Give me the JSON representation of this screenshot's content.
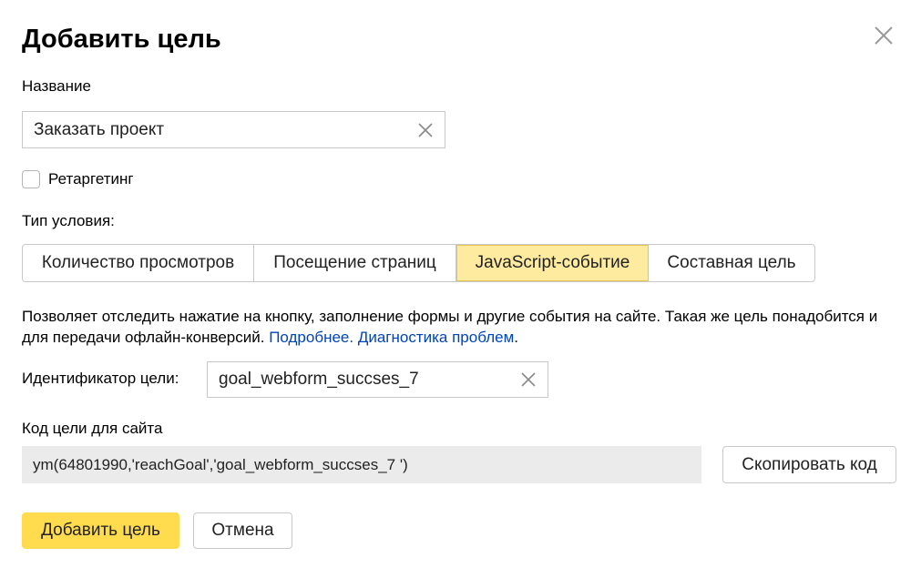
{
  "dialog": {
    "title": "Добавить цель"
  },
  "name_field": {
    "label": "Название",
    "value": "Заказать проект"
  },
  "retargeting": {
    "label": "Ретаргетинг",
    "checked": false
  },
  "condition_type": {
    "label": "Тип условия:",
    "options": [
      {
        "label": "Количество просмотров",
        "selected": false
      },
      {
        "label": "Посещение страниц",
        "selected": false
      },
      {
        "label": "JavaScript-событие",
        "selected": true
      },
      {
        "label": "Составная цель",
        "selected": false
      }
    ]
  },
  "description": {
    "text": "Позволяет отследить нажатие на кнопку, заполнение формы и другие события на сайте. Такая же цель понадобится и для передачи офлайн-конверсий.",
    "link_more": "Подробнее.",
    "link_diagnostics": "Диагностика проблем",
    "suffix": "."
  },
  "goal_id": {
    "label": "Идентификатор цели:",
    "value": "goal_webform_succses_7"
  },
  "site_code": {
    "label": "Код цели для сайта",
    "code": "ym(64801990,'reachGoal','goal_webform_succses_7 ')",
    "copy_label": "Скопировать код"
  },
  "actions": {
    "submit_label": "Добавить цель",
    "cancel_label": "Отмена"
  },
  "colors": {
    "accent": "#ffdb4d",
    "selected_tab_bg": "#ffeba0",
    "link": "#0044bb",
    "code_bg": "#ebebeb"
  },
  "icons": {
    "close": "close-icon",
    "clear": "clear-icon"
  }
}
